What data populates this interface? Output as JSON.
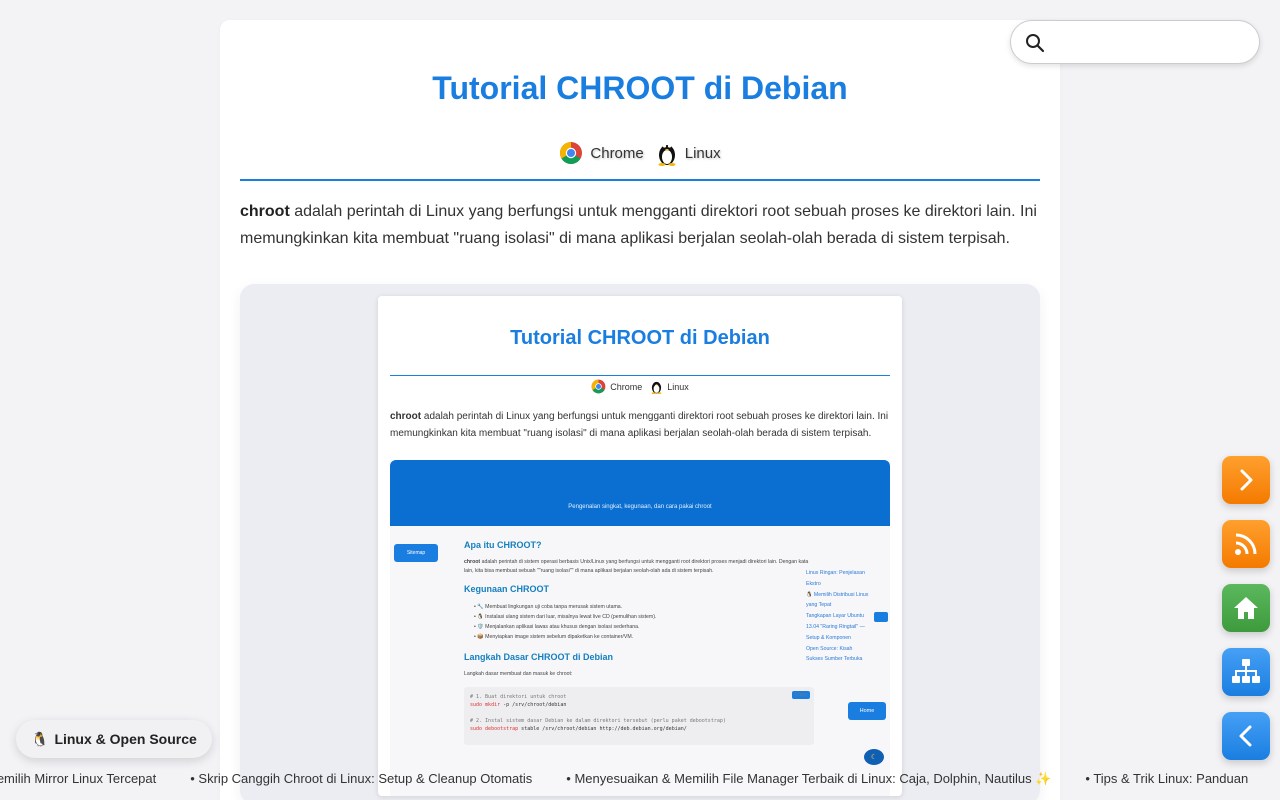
{
  "article": {
    "title": "Tutorial CHROOT di Debian",
    "tags": [
      {
        "label": "Chrome",
        "icon": "chrome-icon"
      },
      {
        "label": "Linux",
        "icon": "tux-penguin-icon"
      }
    ],
    "intro_bold": "chroot",
    "intro_rest": " adalah perintah di Linux yang berfungsi untuk mengganti direktori root sebuah proses ke direktori lain. Ini memungkinkan kita membuat \"ruang isolasi\" di mana aplikasi berjalan seolah-olah berada di sistem terpisah."
  },
  "preview": {
    "title": "Tutorial CHROOT di Debian",
    "tags": [
      "Chrome",
      "Linux"
    ],
    "intro_bold": "chroot",
    "intro_rest": " adalah perintah di Linux yang berfungsi untuk mengganti direktori root sebuah proses ke direktori lain. Ini memungkinkan kita membuat \"ruang isolasi\" di mana aplikasi berjalan seolah-olah berada di sistem terpisah.",
    "hero_subtitle": "Pengenalan singkat, kegunaan, dan cara pakai chroot",
    "sitemap_label": "Sitemap",
    "h_what": "Apa itu CHROOT?",
    "what_bold": "chroot",
    "what_text": " adalah perintah di sistem operasi berbasis Unix/Linux yang berfungsi untuk mengganti root direktori proses menjadi direktori lain. Dengan kata lain, kita bisa membuat sebuah \"\"ruang isolasi\"\" di mana aplikasi berjalan seolah-olah ada di sistem terpisah.",
    "h_uses": "Kegunaan CHROOT",
    "uses": [
      "🔧 Membuat lingkungan uji coba tanpa merusak sistem utama.",
      "🐧 Instalasi ulang sistem dari luar, misalnya lewat live CD (pemulihan sistem).",
      "🛡️ Menjalankan aplikasi lawas atau khusus dengan isolasi sederhana.",
      "📦 Menyiapkan image sistem sebelum dipaketkan ke container/VM."
    ],
    "h_steps": "Langkah Dasar CHROOT di Debian",
    "steps_text": "Langkah dasar membuat dan masuk ke chroot:",
    "code_comment_1": "# 1. Buat direktori untuk chroot",
    "code_kw_1": "sudo mkdir",
    "code_rest_1": " -p /srv/chroot/debian",
    "code_comment_2": "# 2. Instal sistem dasar Debian ke dalam direktori tersebut (perlu paket debootstrap)",
    "code_kw_2": "sudo debootstrap",
    "code_rest_2": " stable /srv/chroot/debian http://deb.debian.org/debian/",
    "copy_label": "Copy",
    "home_label": "Home",
    "side_links": [
      "Linux Ringan: Penjelasan",
      "Ekstro",
      "🐧 Memilih Distribusi Linux",
      "yang Tepat",
      "Tangkapan Layar Ubuntu",
      "13.04 \"Raring Ringtail\" —",
      "Setup & Komponen",
      "Open Source: Kisah",
      "Sukses Sumber Terbuka"
    ]
  },
  "search": {
    "placeholder": "",
    "value": ""
  },
  "fabs": [
    {
      "name": "next-button",
      "icon": "chevron-right-icon",
      "color": "orange"
    },
    {
      "name": "rss-button",
      "icon": "rss-icon",
      "color": "orange"
    },
    {
      "name": "home-button",
      "icon": "home-icon",
      "color": "green"
    },
    {
      "name": "sitemap-button",
      "icon": "sitemap-icon",
      "color": "blue"
    },
    {
      "name": "back-button",
      "icon": "chevron-left-icon",
      "color": "blue"
    }
  ],
  "badge": {
    "icon": "🐧",
    "label": "Linux & Open Source"
  },
  "ticker": [
    "Memilih Mirror Linux Tercepat",
    "• Skrip Canggih Chroot di Linux: Setup & Cleanup Otomatis",
    "• Menyesuaikan & Memilih File Manager Terbaik di Linux: Caja, Dolphin, Nautilus ✨",
    "• Tips & Trik Linux: Panduan"
  ],
  "colors": {
    "accent": "#1a7ee0",
    "orange": "#f47a00",
    "green": "#3d9a3d",
    "background": "#f3f3f6"
  }
}
